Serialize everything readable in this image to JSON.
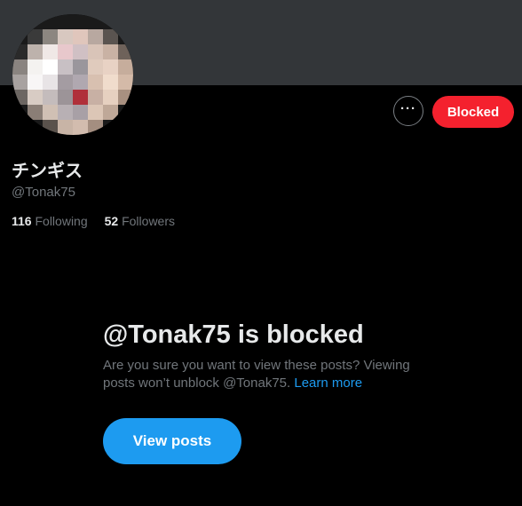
{
  "profile": {
    "display_name": "チンギス",
    "handle": "@Tonak75",
    "following_count": "116",
    "following_label": "Following",
    "followers_count": "52",
    "followers_label": "Followers"
  },
  "actions": {
    "more_icon": "more-horizontal-icon",
    "blocked_label": "Blocked"
  },
  "blocked_notice": {
    "title": "@Tonak75 is blocked",
    "description": "Are you sure you want to view these posts? Viewing posts won’t unblock @Tonak75.",
    "learn_more": "Learn more",
    "view_posts_label": "View posts"
  },
  "colors": {
    "background": "#000000",
    "banner": "#333639",
    "blocked_button": "#f4212e",
    "accent_blue": "#1d9bf0",
    "primary_text": "#e7e9ea",
    "secondary_text": "#71767b"
  }
}
